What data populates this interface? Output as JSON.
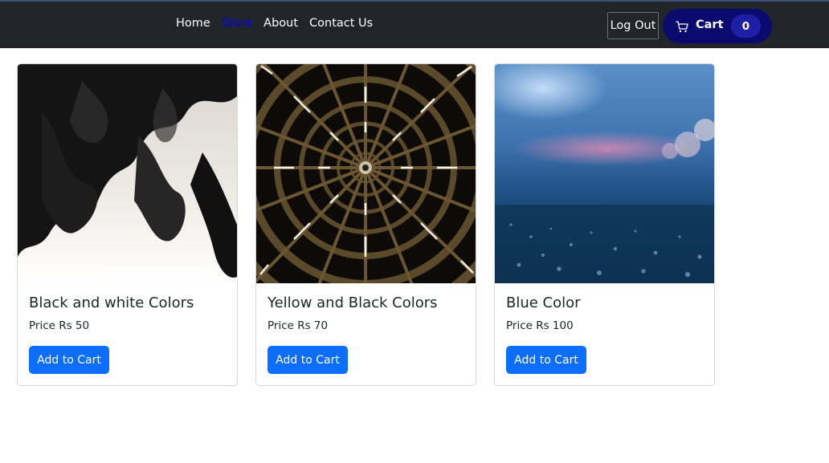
{
  "navbar": {
    "links": [
      {
        "label": "Home"
      },
      {
        "label": "Store",
        "active": true
      },
      {
        "label": "About"
      },
      {
        "label": "Contact Us"
      }
    ],
    "logout_label": "Log Out",
    "cart": {
      "label": "Cart",
      "count": "0"
    }
  },
  "products": [
    {
      "title": "Black and white Colors",
      "price": "Price Rs 50",
      "button": "Add to Cart",
      "image": "black-ink-in-water"
    },
    {
      "title": "Yellow and Black Colors",
      "price": "Price Rs 70",
      "button": "Add to Cart",
      "image": "radial-tunnel-lights"
    },
    {
      "title": "Blue Color",
      "price": "Price Rs 100",
      "button": "Add to Cart",
      "image": "blue-bokeh-road"
    }
  ],
  "colors": {
    "navbar_bg": "#212529",
    "active_link": "#0000ff",
    "cart_bg": "#0a0a6e",
    "primary_button": "#0d6efd"
  }
}
